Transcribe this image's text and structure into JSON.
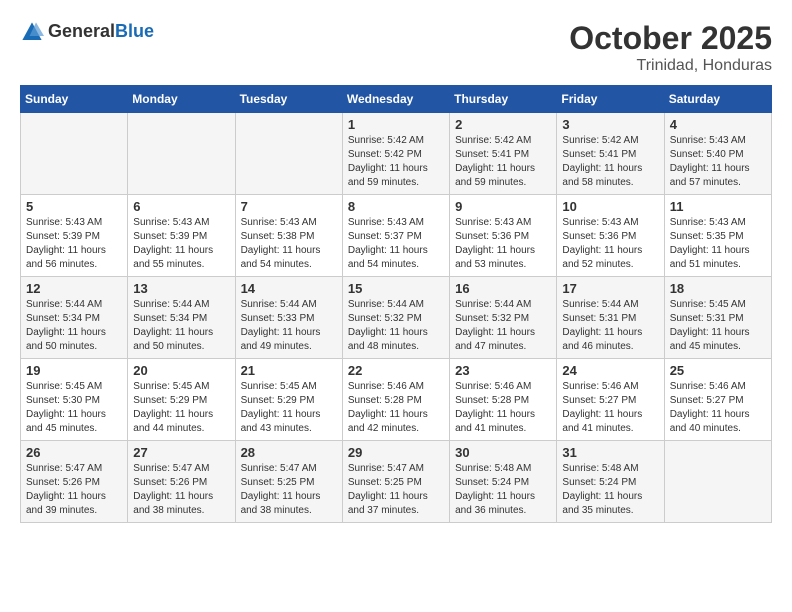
{
  "header": {
    "logo_general": "General",
    "logo_blue": "Blue",
    "month": "October 2025",
    "location": "Trinidad, Honduras"
  },
  "weekdays": [
    "Sunday",
    "Monday",
    "Tuesday",
    "Wednesday",
    "Thursday",
    "Friday",
    "Saturday"
  ],
  "weeks": [
    [
      {
        "day": "",
        "sunrise": "",
        "sunset": "",
        "daylight": ""
      },
      {
        "day": "",
        "sunrise": "",
        "sunset": "",
        "daylight": ""
      },
      {
        "day": "",
        "sunrise": "",
        "sunset": "",
        "daylight": ""
      },
      {
        "day": "1",
        "sunrise": "Sunrise: 5:42 AM",
        "sunset": "Sunset: 5:42 PM",
        "daylight": "Daylight: 11 hours and 59 minutes."
      },
      {
        "day": "2",
        "sunrise": "Sunrise: 5:42 AM",
        "sunset": "Sunset: 5:41 PM",
        "daylight": "Daylight: 11 hours and 59 minutes."
      },
      {
        "day": "3",
        "sunrise": "Sunrise: 5:42 AM",
        "sunset": "Sunset: 5:41 PM",
        "daylight": "Daylight: 11 hours and 58 minutes."
      },
      {
        "day": "4",
        "sunrise": "Sunrise: 5:43 AM",
        "sunset": "Sunset: 5:40 PM",
        "daylight": "Daylight: 11 hours and 57 minutes."
      }
    ],
    [
      {
        "day": "5",
        "sunrise": "Sunrise: 5:43 AM",
        "sunset": "Sunset: 5:39 PM",
        "daylight": "Daylight: 11 hours and 56 minutes."
      },
      {
        "day": "6",
        "sunrise": "Sunrise: 5:43 AM",
        "sunset": "Sunset: 5:39 PM",
        "daylight": "Daylight: 11 hours and 55 minutes."
      },
      {
        "day": "7",
        "sunrise": "Sunrise: 5:43 AM",
        "sunset": "Sunset: 5:38 PM",
        "daylight": "Daylight: 11 hours and 54 minutes."
      },
      {
        "day": "8",
        "sunrise": "Sunrise: 5:43 AM",
        "sunset": "Sunset: 5:37 PM",
        "daylight": "Daylight: 11 hours and 54 minutes."
      },
      {
        "day": "9",
        "sunrise": "Sunrise: 5:43 AM",
        "sunset": "Sunset: 5:36 PM",
        "daylight": "Daylight: 11 hours and 53 minutes."
      },
      {
        "day": "10",
        "sunrise": "Sunrise: 5:43 AM",
        "sunset": "Sunset: 5:36 PM",
        "daylight": "Daylight: 11 hours and 52 minutes."
      },
      {
        "day": "11",
        "sunrise": "Sunrise: 5:43 AM",
        "sunset": "Sunset: 5:35 PM",
        "daylight": "Daylight: 11 hours and 51 minutes."
      }
    ],
    [
      {
        "day": "12",
        "sunrise": "Sunrise: 5:44 AM",
        "sunset": "Sunset: 5:34 PM",
        "daylight": "Daylight: 11 hours and 50 minutes."
      },
      {
        "day": "13",
        "sunrise": "Sunrise: 5:44 AM",
        "sunset": "Sunset: 5:34 PM",
        "daylight": "Daylight: 11 hours and 50 minutes."
      },
      {
        "day": "14",
        "sunrise": "Sunrise: 5:44 AM",
        "sunset": "Sunset: 5:33 PM",
        "daylight": "Daylight: 11 hours and 49 minutes."
      },
      {
        "day": "15",
        "sunrise": "Sunrise: 5:44 AM",
        "sunset": "Sunset: 5:32 PM",
        "daylight": "Daylight: 11 hours and 48 minutes."
      },
      {
        "day": "16",
        "sunrise": "Sunrise: 5:44 AM",
        "sunset": "Sunset: 5:32 PM",
        "daylight": "Daylight: 11 hours and 47 minutes."
      },
      {
        "day": "17",
        "sunrise": "Sunrise: 5:44 AM",
        "sunset": "Sunset: 5:31 PM",
        "daylight": "Daylight: 11 hours and 46 minutes."
      },
      {
        "day": "18",
        "sunrise": "Sunrise: 5:45 AM",
        "sunset": "Sunset: 5:31 PM",
        "daylight": "Daylight: 11 hours and 45 minutes."
      }
    ],
    [
      {
        "day": "19",
        "sunrise": "Sunrise: 5:45 AM",
        "sunset": "Sunset: 5:30 PM",
        "daylight": "Daylight: 11 hours and 45 minutes."
      },
      {
        "day": "20",
        "sunrise": "Sunrise: 5:45 AM",
        "sunset": "Sunset: 5:29 PM",
        "daylight": "Daylight: 11 hours and 44 minutes."
      },
      {
        "day": "21",
        "sunrise": "Sunrise: 5:45 AM",
        "sunset": "Sunset: 5:29 PM",
        "daylight": "Daylight: 11 hours and 43 minutes."
      },
      {
        "day": "22",
        "sunrise": "Sunrise: 5:46 AM",
        "sunset": "Sunset: 5:28 PM",
        "daylight": "Daylight: 11 hours and 42 minutes."
      },
      {
        "day": "23",
        "sunrise": "Sunrise: 5:46 AM",
        "sunset": "Sunset: 5:28 PM",
        "daylight": "Daylight: 11 hours and 41 minutes."
      },
      {
        "day": "24",
        "sunrise": "Sunrise: 5:46 AM",
        "sunset": "Sunset: 5:27 PM",
        "daylight": "Daylight: 11 hours and 41 minutes."
      },
      {
        "day": "25",
        "sunrise": "Sunrise: 5:46 AM",
        "sunset": "Sunset: 5:27 PM",
        "daylight": "Daylight: 11 hours and 40 minutes."
      }
    ],
    [
      {
        "day": "26",
        "sunrise": "Sunrise: 5:47 AM",
        "sunset": "Sunset: 5:26 PM",
        "daylight": "Daylight: 11 hours and 39 minutes."
      },
      {
        "day": "27",
        "sunrise": "Sunrise: 5:47 AM",
        "sunset": "Sunset: 5:26 PM",
        "daylight": "Daylight: 11 hours and 38 minutes."
      },
      {
        "day": "28",
        "sunrise": "Sunrise: 5:47 AM",
        "sunset": "Sunset: 5:25 PM",
        "daylight": "Daylight: 11 hours and 38 minutes."
      },
      {
        "day": "29",
        "sunrise": "Sunrise: 5:47 AM",
        "sunset": "Sunset: 5:25 PM",
        "daylight": "Daylight: 11 hours and 37 minutes."
      },
      {
        "day": "30",
        "sunrise": "Sunrise: 5:48 AM",
        "sunset": "Sunset: 5:24 PM",
        "daylight": "Daylight: 11 hours and 36 minutes."
      },
      {
        "day": "31",
        "sunrise": "Sunrise: 5:48 AM",
        "sunset": "Sunset: 5:24 PM",
        "daylight": "Daylight: 11 hours and 35 minutes."
      },
      {
        "day": "",
        "sunrise": "",
        "sunset": "",
        "daylight": ""
      }
    ]
  ]
}
